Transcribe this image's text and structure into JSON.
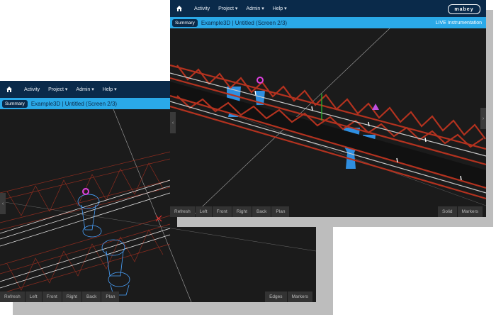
{
  "back_window": {
    "nav": {
      "items": [
        "Activity",
        "Project ▾",
        "Admin ▾",
        "Help ▾"
      ]
    },
    "summary_label": "Summary",
    "breadcrumb": "Example3D | Untitled (Screen 2/3)",
    "view_buttons": [
      "Refresh",
      "Left",
      "Front",
      "Right",
      "Back",
      "Plan"
    ],
    "mode_buttons": [
      "Edges",
      "Markers"
    ]
  },
  "front_window": {
    "nav": {
      "items": [
        "Activity",
        "Project ▾",
        "Admin ▾",
        "Help ▾"
      ]
    },
    "logo_text": "mabey",
    "summary_label": "Summary",
    "breadcrumb": "Example3D | Untitled (Screen 2/3)",
    "status": "LIVE Instrumentation",
    "view_buttons": [
      "Refresh",
      "Left",
      "Front",
      "Right",
      "Back",
      "Plan"
    ],
    "mode_buttons": [
      "Solid",
      "Markers"
    ]
  },
  "colors": {
    "navbar": "#0a2a4a",
    "subbar": "#2aa9e8",
    "truss": "#b3321f",
    "pier": "#2f8fe0"
  },
  "icons": {
    "home": "home-icon",
    "collapse": "chevron-left-icon",
    "expand": "chevron-right-icon"
  }
}
